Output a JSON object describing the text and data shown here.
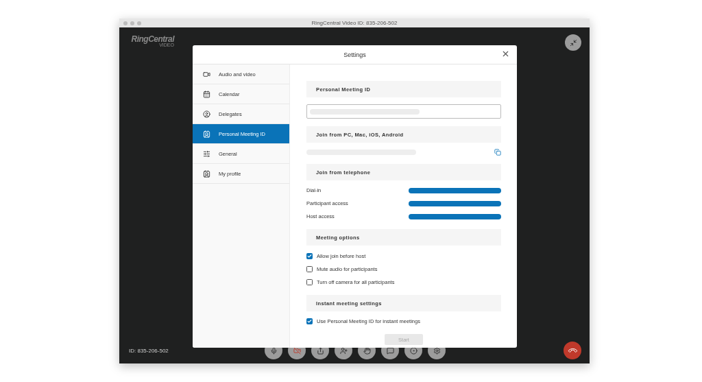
{
  "window": {
    "title": "RingCentral Video ID: 835-206-502"
  },
  "logo": {
    "name": "RingCentral",
    "tagline": "VIDEO"
  },
  "meeting_id": "ID: 835-206-502",
  "toolbar": [
    {
      "kind": "mic"
    },
    {
      "kind": "camera-off"
    },
    {
      "kind": "share"
    },
    {
      "kind": "participant"
    },
    {
      "kind": "raise"
    },
    {
      "kind": "chat"
    },
    {
      "kind": "record"
    },
    {
      "kind": "settings"
    }
  ],
  "settings": {
    "title": "Settings",
    "sidebar": {
      "items": [
        {
          "label": "Audio and video",
          "selected": false
        },
        {
          "label": "Calendar",
          "selected": false
        },
        {
          "label": "Delegates",
          "selected": false
        },
        {
          "label": "Personal Meeting ID",
          "selected": true
        },
        {
          "label": "General",
          "selected": false
        },
        {
          "label": "My profile",
          "selected": false
        }
      ]
    },
    "sections": [
      {
        "heading": "Personal Meeting ID",
        "kind": "field"
      },
      {
        "heading": "Join from PC, Mac, iOS, Android",
        "kind": "link"
      },
      {
        "heading": "Join from telephone",
        "kind": "phone",
        "rows": [
          "Dial-in",
          "Participant access",
          "Host access"
        ]
      },
      {
        "heading": "Meeting options",
        "kind": "options",
        "options": [
          {
            "label": "Allow join before host",
            "checked": true
          },
          {
            "label": "Mute audio for participants",
            "checked": false
          },
          {
            "label": "Turn off camera for all participants",
            "checked": false
          }
        ]
      },
      {
        "heading": "Instant meeting settings",
        "kind": "options",
        "options": [
          {
            "label": "Use Personal Meeting ID for instant meetings",
            "checked": true
          }
        ]
      }
    ],
    "start_button": {
      "label": "Start",
      "disabled": true
    }
  }
}
